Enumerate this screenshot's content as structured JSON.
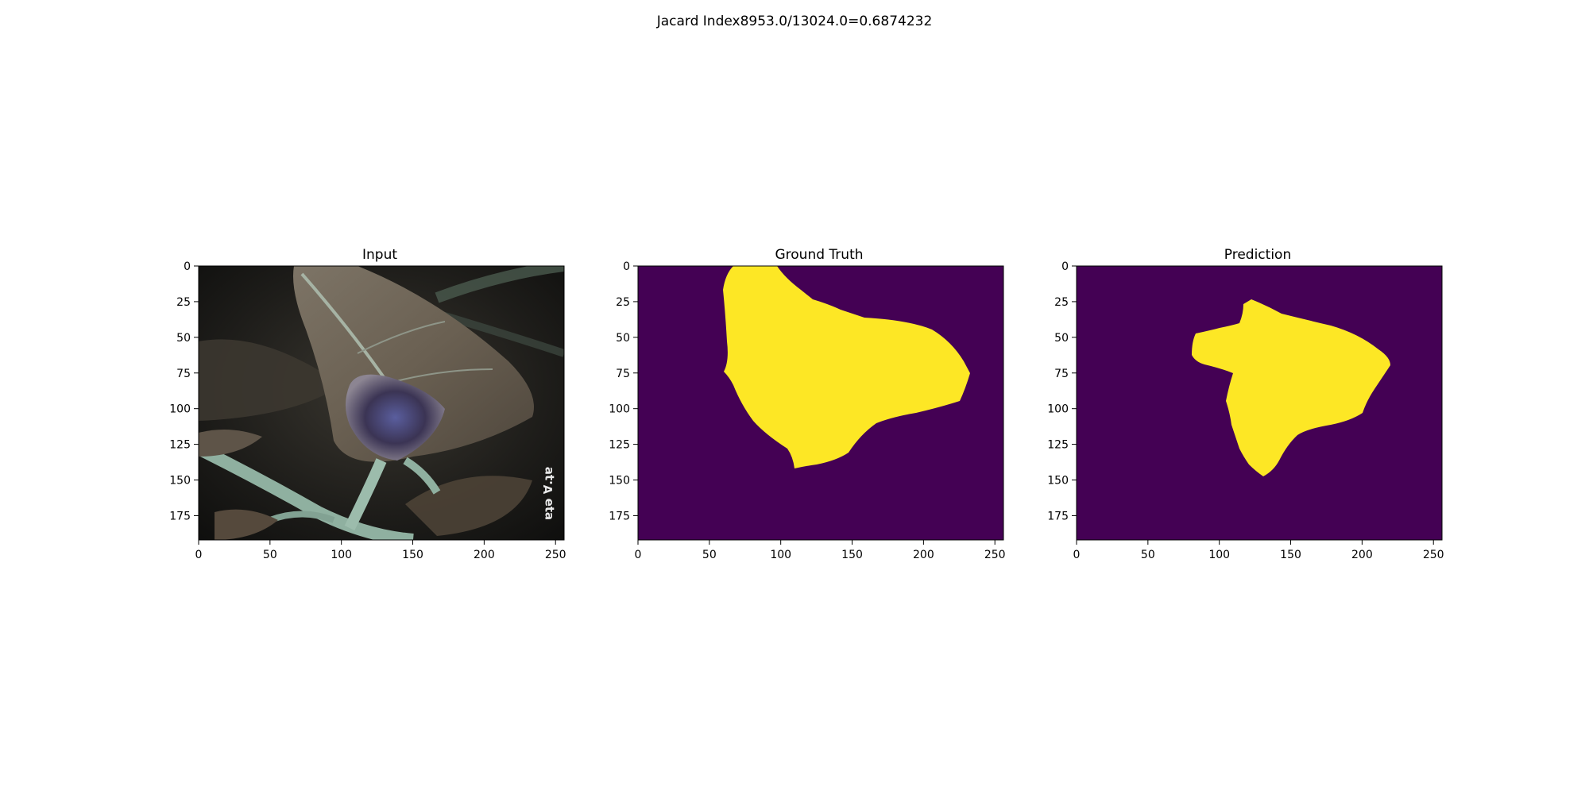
{
  "figure": {
    "title": "Jacard Index8953.0/13024.0=0.6874232"
  },
  "axes": {
    "x_ticks": [
      "0",
      "50",
      "100",
      "150",
      "200",
      "250"
    ],
    "x_tick_values": [
      0,
      50,
      100,
      150,
      200,
      250
    ],
    "y_ticks": [
      "0",
      "25",
      "50",
      "75",
      "100",
      "125",
      "150",
      "175"
    ],
    "y_tick_values": [
      0,
      25,
      50,
      75,
      100,
      125,
      150,
      175
    ],
    "x_range": [
      0,
      256
    ],
    "y_range": [
      0,
      192
    ]
  },
  "panels": [
    {
      "id": "input",
      "title": "Input"
    },
    {
      "id": "ground-truth",
      "title": "Ground Truth"
    },
    {
      "id": "prediction",
      "title": "Prediction"
    }
  ],
  "colors": {
    "mask_background": "#440154",
    "mask_foreground": "#fde725",
    "frame": "#000000"
  }
}
